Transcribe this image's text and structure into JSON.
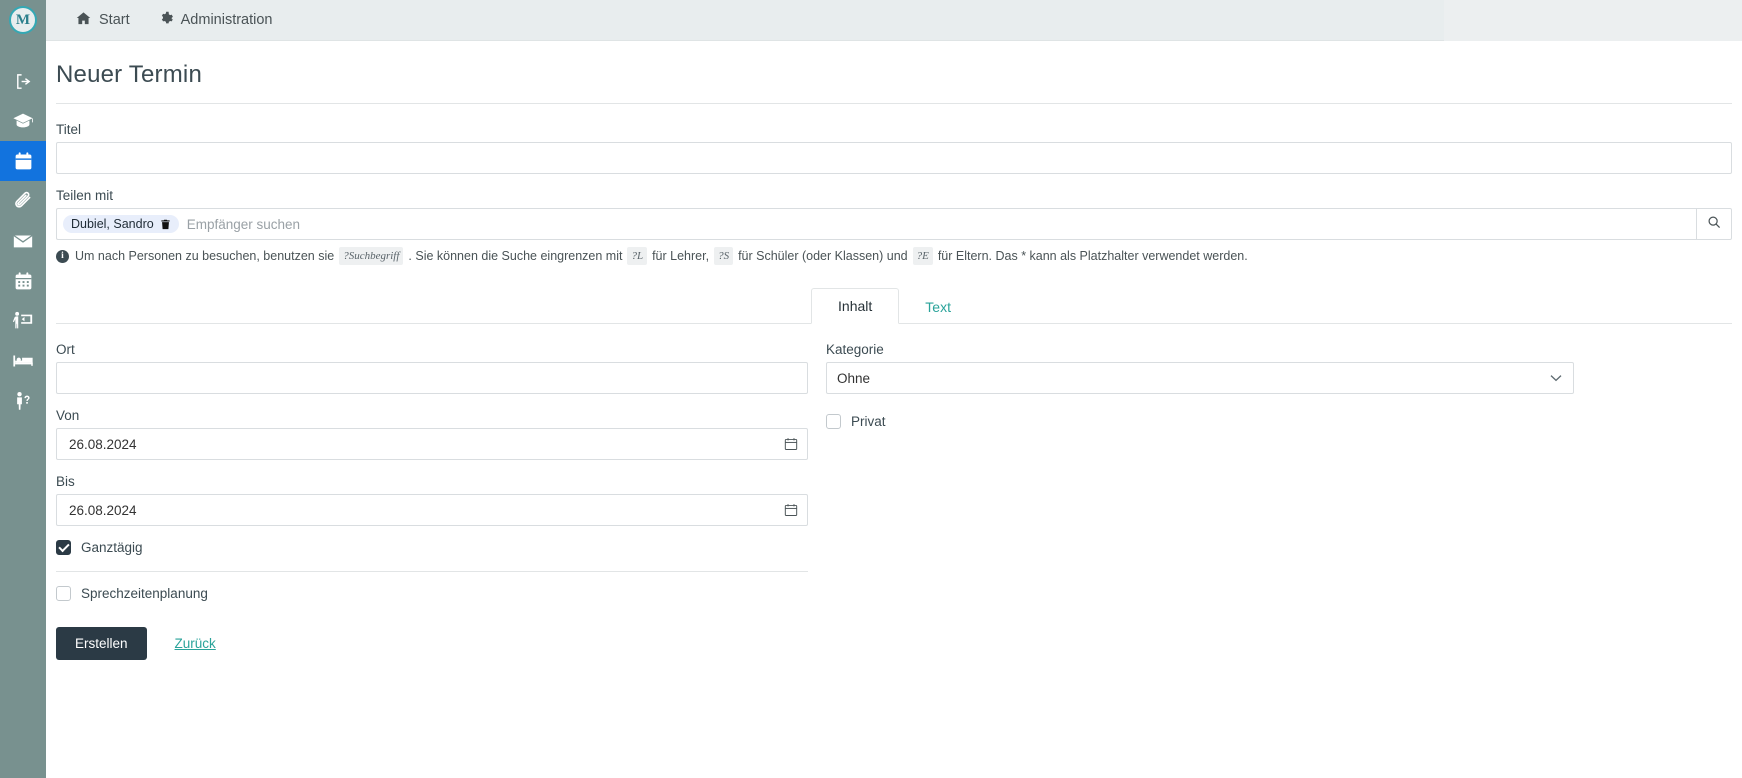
{
  "topbar": {
    "logo_label": "M",
    "nav": [
      {
        "label": "Start",
        "icon": "home-icon"
      },
      {
        "label": "Administration",
        "icon": "gear-icon"
      }
    ]
  },
  "sidebar": {
    "items": [
      {
        "icon": "logout-icon",
        "name": "sidebar-item-logout",
        "active": false
      },
      {
        "icon": "graduation-cap-icon",
        "name": "sidebar-item-courses",
        "active": false
      },
      {
        "icon": "calendar-icon",
        "name": "sidebar-item-calendar",
        "active": true
      },
      {
        "icon": "paperclip-icon",
        "name": "sidebar-item-attachments",
        "active": false
      },
      {
        "icon": "envelope-icon",
        "name": "sidebar-item-mail",
        "active": false
      },
      {
        "icon": "calendar-days-icon",
        "name": "sidebar-item-schedule",
        "active": false
      },
      {
        "icon": "presentation-icon",
        "name": "sidebar-item-teaching",
        "active": false
      },
      {
        "icon": "bed-icon",
        "name": "sidebar-item-boarding",
        "active": false
      },
      {
        "icon": "person-question-icon",
        "name": "sidebar-item-support",
        "active": false
      }
    ]
  },
  "page": {
    "title": "Neuer Termin"
  },
  "form": {
    "title_label": "Titel",
    "title_value": "",
    "title_placeholder": "",
    "share_label": "Teilen mit",
    "share_chip": "Dubiel, Sandro",
    "share_placeholder": "Empfänger suchen",
    "hint": {
      "prefix": "Um nach Personen zu besuchen, benutzen sie",
      "code_search": "?Suchbegriff",
      "mid1": ". Sie können die Suche eingrenzen mit",
      "code_teacher": "?L",
      "mid2": "für Lehrer,",
      "code_student": "?S",
      "mid3": "für Schüler (oder Klassen) und",
      "code_parent": "?E",
      "suffix": "für Eltern. Das * kann als Platzhalter verwendet werden."
    }
  },
  "tabs": [
    {
      "label": "Inhalt",
      "active": true
    },
    {
      "label": "Text",
      "active": false
    }
  ],
  "content": {
    "ort_label": "Ort",
    "ort_value": "",
    "von_label": "Von",
    "von_value": "26.08.2024",
    "bis_label": "Bis",
    "bis_value": "26.08.2024",
    "ganztaegig_label": "Ganztägig",
    "ganztaegig_checked": true,
    "sprechzeit_label": "Sprechzeitenplanung",
    "sprechzeit_checked": false,
    "kategorie_label": "Kategorie",
    "kategorie_value": "Ohne",
    "kategorie_options": [
      "Ohne"
    ],
    "privat_label": "Privat",
    "privat_checked": false
  },
  "actions": {
    "submit_label": "Erstellen",
    "back_label": "Zurück"
  },
  "colors": {
    "sidebar": "#78918f",
    "sidebar_active": "#1273de",
    "topbar": "#e8edee",
    "accent_teal": "#2aa39a",
    "button_dark": "#2b3a45",
    "chip_bg": "#e8eefb"
  }
}
